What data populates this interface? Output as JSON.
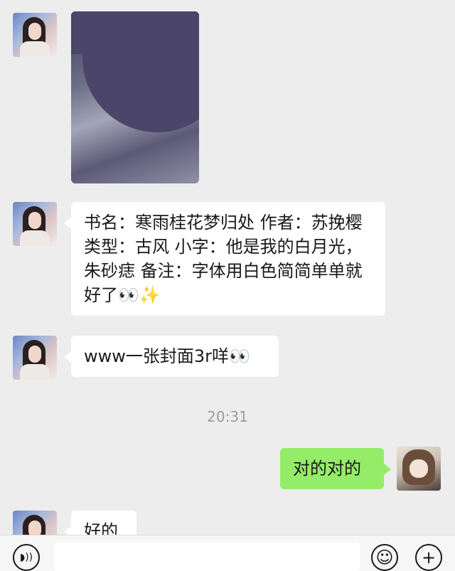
{
  "messages": [
    {
      "type": "image",
      "sender": "other"
    },
    {
      "type": "text",
      "sender": "other",
      "text": "书名：寒雨桂花梦归处  作者：苏挽樱  类型：古风  小字：他是我的白月光，朱砂痣  备注：字体用白色简简单单就好了👀✨"
    },
    {
      "type": "text",
      "sender": "other",
      "text": "www一张封面3r咩👀"
    },
    {
      "type": "timestamp",
      "text": "20:31"
    },
    {
      "type": "text",
      "sender": "me",
      "text": "对的对的"
    },
    {
      "type": "text",
      "sender": "other",
      "text": "好的"
    }
  ],
  "bottom_bar": {
    "voice_icon": "voice-icon",
    "emoji_icon": "emoji-icon",
    "plus_icon": "plus-icon",
    "emoji_glyph": "☺",
    "plus_glyph": "+",
    "voice_glyph": "◗))"
  },
  "colors": {
    "background": "#ededed",
    "bubble_other": "#ffffff",
    "bubble_me": "#95ec69",
    "timestamp": "#9b9b9b"
  }
}
